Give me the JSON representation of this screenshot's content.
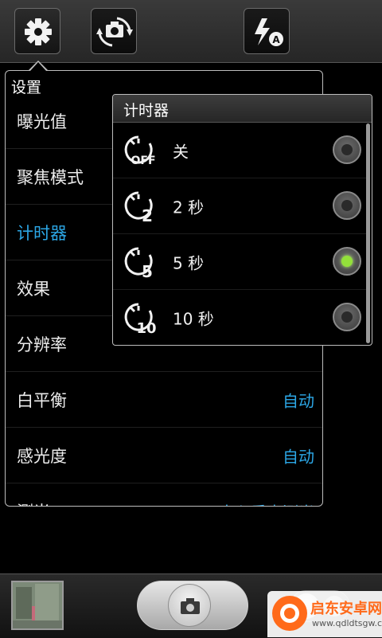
{
  "toolbar": {
    "settings_icon": "gear-icon",
    "switch_camera_icon": "switch-camera-icon",
    "flash_icon": "flash-auto-icon"
  },
  "settings": {
    "title": "设置",
    "rows": [
      {
        "label": "曝光值",
        "value": ""
      },
      {
        "label": "聚焦模式",
        "value": ""
      },
      {
        "label": "计时器",
        "value": "",
        "highlighted": true
      },
      {
        "label": "效果",
        "value": ""
      },
      {
        "label": "分辨率",
        "value": ""
      },
      {
        "label": "白平衡",
        "value": "自动"
      },
      {
        "label": "感光度",
        "value": "自动"
      },
      {
        "label": "测光",
        "value": "中心重点测光"
      }
    ]
  },
  "timer_popup": {
    "title": "计时器",
    "options": [
      {
        "label": "关",
        "icon": "timer-off-icon",
        "badge": "OFF",
        "selected": false
      },
      {
        "label": "2 秒",
        "icon": "timer-2-icon",
        "badge": "2",
        "selected": false
      },
      {
        "label": "5 秒",
        "icon": "timer-5-icon",
        "badge": "5",
        "selected": true
      },
      {
        "label": "10 秒",
        "icon": "timer-10-icon",
        "badge": "10",
        "selected": false
      }
    ]
  },
  "bottom_bar": {
    "shutter_icon": "camera-icon",
    "mode_switch_icon": "camera-video-switch-icon"
  },
  "watermark": {
    "brand": "启东安卓网",
    "url": "www.qdldtsgw.com"
  },
  "colors": {
    "accent_blue": "#2ca7e6",
    "selected_green": "#93e03a"
  }
}
